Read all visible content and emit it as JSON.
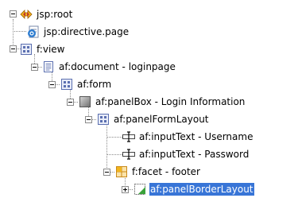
{
  "tree": {
    "nodes": [
      {
        "label": "jsp:root",
        "icon": "jsp-root-icon",
        "toggle": "collapse"
      },
      {
        "label": "jsp:directive.page",
        "icon": "directive-icon",
        "toggle": "none"
      },
      {
        "label": "f:view",
        "icon": "view-icon",
        "toggle": "collapse"
      },
      {
        "label": "af:document - loginpage",
        "icon": "document-icon",
        "toggle": "collapse"
      },
      {
        "label": "af:form",
        "icon": "form-icon",
        "toggle": "collapse"
      },
      {
        "label": "af:panelBox - Login Information",
        "icon": "panel-box-icon",
        "toggle": "collapse"
      },
      {
        "label": "af:panelFormLayout",
        "icon": "panel-form-layout-icon",
        "toggle": "collapse"
      },
      {
        "label": "af:inputText - Username",
        "icon": "input-text-icon",
        "toggle": "none"
      },
      {
        "label": "af:inputText - Password",
        "icon": "input-text-icon",
        "toggle": "none"
      },
      {
        "label": "f:facet - footer",
        "icon": "facet-icon",
        "toggle": "collapse"
      },
      {
        "label": "af:panelBorderLayout",
        "icon": "panel-border-layout-icon",
        "toggle": "expand",
        "selected": true
      }
    ]
  }
}
